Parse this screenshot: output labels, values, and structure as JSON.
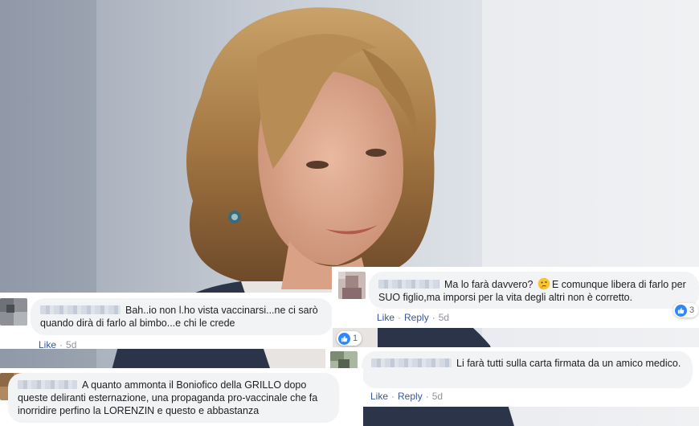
{
  "comments": [
    {
      "text": "Bah..io non l.ho vista vaccinarsi...ne ci sarò quando dirà di farlo al bimbo...e chi le crede",
      "actions": {
        "like": "Like",
        "time": "5d"
      },
      "reaction_count": "1"
    },
    {
      "text_before": "Ma lo farà davvero?",
      "text_after": "E comunque libera di farlo per SUO figlio,ma imporsi per la vita degli altri non è corretto.",
      "emoji": "thinking-face",
      "actions": {
        "like": "Like",
        "reply": "Reply",
        "time": "5d"
      },
      "reaction_count": "3"
    },
    {
      "text": "Li farà tutti sulla carta firmata da un amico medico.",
      "actions": {
        "like": "Like",
        "reply": "Reply",
        "time": "5d"
      }
    },
    {
      "text": "A quanto ammonta il Boniofico della GRILLO dopo queste deliranti esternazione, una propaganda pro-vaccinale che fa inorridire perfino la LORENZIN e questo e abbastanza"
    }
  ],
  "separator": "·",
  "colors": {
    "link": "#385898",
    "bubble": "#f2f3f5",
    "like_badge": "#2d88ff"
  }
}
